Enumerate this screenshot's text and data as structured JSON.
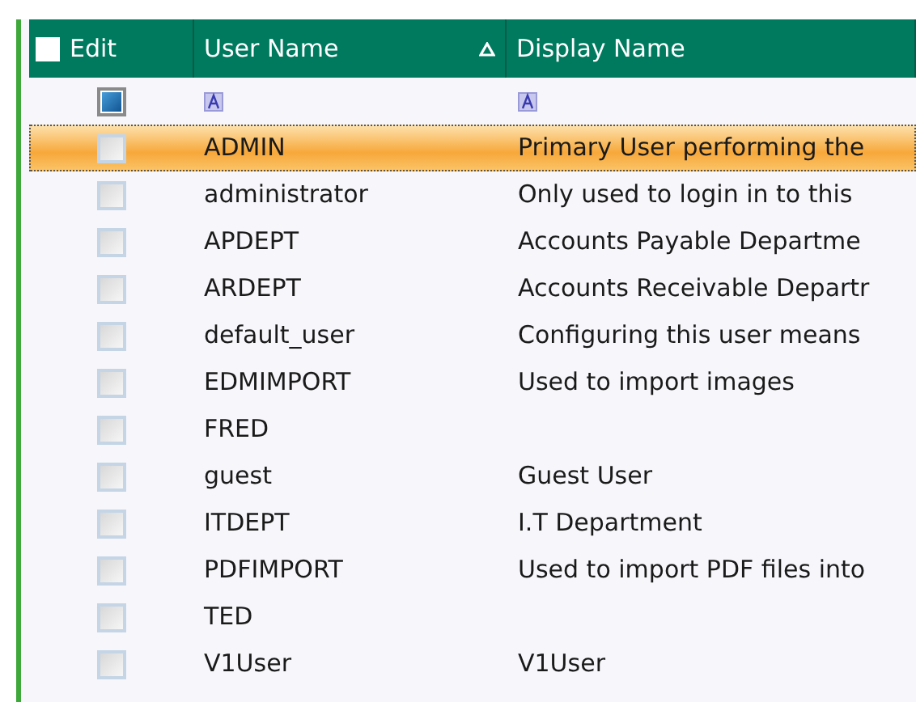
{
  "header": {
    "select_all_checked": false,
    "columns": [
      {
        "label": "Edit"
      },
      {
        "label": "User Name",
        "sort_ascending": true
      },
      {
        "label": "Display Name"
      }
    ]
  },
  "filter_row": {
    "checked": true
  },
  "rows": [
    {
      "user": "ADMIN",
      "display": "Primary User performing the",
      "checked": false,
      "selected": true
    },
    {
      "user": "administrator",
      "display": "Only used to login in to this",
      "checked": false,
      "selected": false
    },
    {
      "user": "APDEPT",
      "display": "Accounts Payable Departme",
      "checked": false,
      "selected": false
    },
    {
      "user": "ARDEPT",
      "display": "Accounts Receivable Departr",
      "checked": false,
      "selected": false
    },
    {
      "user": "default_user",
      "display": "Configuring this user means",
      "checked": false,
      "selected": false
    },
    {
      "user": "EDMIMPORT",
      "display": "Used to import images",
      "checked": false,
      "selected": false
    },
    {
      "user": "FRED",
      "checked": false,
      "selected": false
    },
    {
      "user": "guest",
      "display": "Guest User",
      "checked": false,
      "selected": false
    },
    {
      "user": "ITDEPT",
      "display": "I.T Department",
      "checked": false,
      "selected": false
    },
    {
      "user": "PDFIMPORT",
      "display": "Used to import PDF files into",
      "checked": false,
      "selected": false
    },
    {
      "user": "TED",
      "checked": false,
      "selected": false
    },
    {
      "user": "V1User",
      "display": "V1User",
      "checked": false,
      "selected": false
    }
  ]
}
